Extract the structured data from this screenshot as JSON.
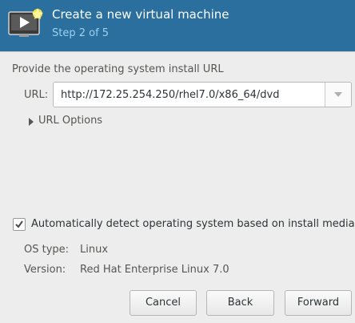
{
  "header": {
    "title": "Create a new virtual machine",
    "subtitle": "Step 2 of 5"
  },
  "install": {
    "section_label": "Provide the operating system install URL",
    "url_label": "URL:",
    "url_value": "http://172.25.254.250/rhel7.0/x86_64/dvd",
    "url_options_label": "URL Options"
  },
  "detect": {
    "checked": true,
    "label": "Automatically detect operating system based on install media",
    "os_type_label": "OS type:",
    "os_type_value": "Linux",
    "version_label": "Version:",
    "version_value": "Red Hat Enterprise Linux 7.0"
  },
  "buttons": {
    "cancel": "Cancel",
    "back": "Back",
    "forward": "Forward"
  },
  "colors": {
    "header_bg": "#2a6f9e",
    "subtitle": "#9ed0f0"
  },
  "icons": {
    "app": "virtual-machine-icon",
    "dropdown": "chevron-down-icon",
    "expander": "triangle-right-icon",
    "checkbox": "checkmark-icon"
  }
}
